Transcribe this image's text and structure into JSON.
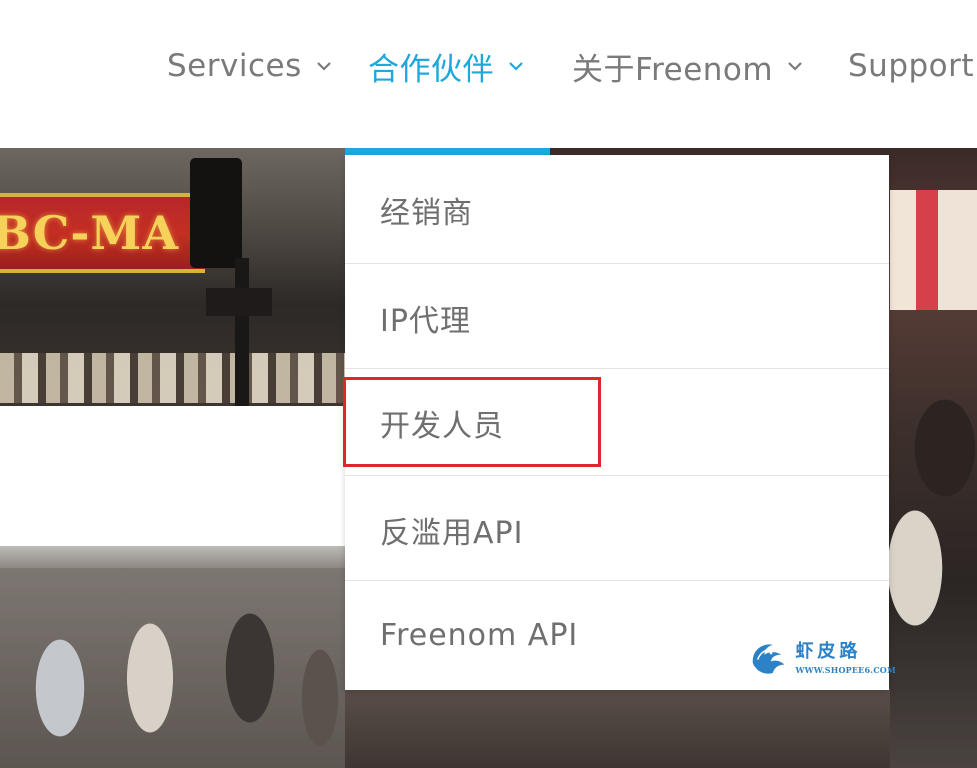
{
  "nav": {
    "items": [
      {
        "label": "Services",
        "active": false
      },
      {
        "label": "合作伙伴",
        "active": true
      },
      {
        "label": "关于Freenom",
        "active": false
      },
      {
        "label": "Support",
        "active": false
      }
    ],
    "accent_color": "#1fa8dc",
    "chevron_icon": "chevron-down-icon"
  },
  "hero": {
    "sign_text": "BC-MA"
  },
  "dropdown": {
    "items": [
      {
        "label": "经销商"
      },
      {
        "label": "IP代理"
      },
      {
        "label": "开发人员",
        "highlighted": true
      },
      {
        "label": "反滥用API"
      },
      {
        "label": "Freenom API"
      }
    ],
    "highlight_color": "#e0262b"
  },
  "watermark": {
    "text_cn": "虾皮路",
    "url": "WWW.SHOPEE6.COM"
  }
}
